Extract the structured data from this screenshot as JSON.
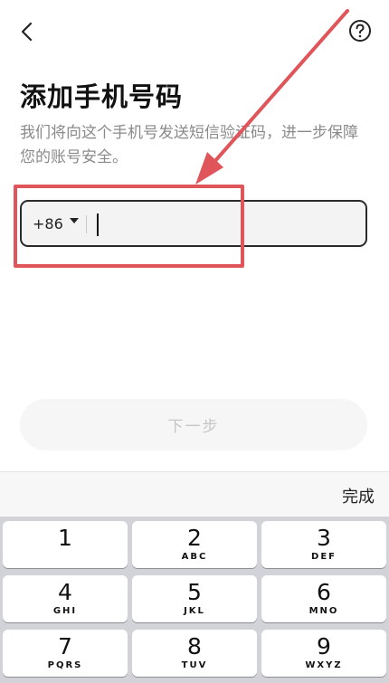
{
  "header": {
    "back_icon": "chevron-left-icon",
    "help_icon": "question-circle-icon"
  },
  "title": "添加手机号码",
  "subtitle": "我们将向这个手机号发送短信验证码，进一步保障您的账号安全。",
  "phone": {
    "country_code": "+86",
    "value": "",
    "placeholder": ""
  },
  "next_button": {
    "label": "下一步"
  },
  "keyboard": {
    "done_label": "完成",
    "keys": [
      {
        "num": "1",
        "letters": ""
      },
      {
        "num": "2",
        "letters": "ABC"
      },
      {
        "num": "3",
        "letters": "DEF"
      },
      {
        "num": "4",
        "letters": "GHI"
      },
      {
        "num": "5",
        "letters": "JKL"
      },
      {
        "num": "6",
        "letters": "MNO"
      },
      {
        "num": "7",
        "letters": "PQRS"
      },
      {
        "num": "8",
        "letters": "TUV"
      },
      {
        "num": "9",
        "letters": "WXYZ"
      }
    ]
  },
  "annotation": {
    "color": "#e0555a"
  }
}
